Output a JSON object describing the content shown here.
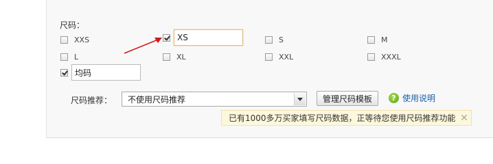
{
  "title": "尺码：",
  "sizes": [
    {
      "label": "XXS",
      "checked": false
    },
    {
      "label": "XS",
      "checked": true,
      "input_value": "XS"
    },
    {
      "label": "S",
      "checked": false
    },
    {
      "label": "M",
      "checked": false
    },
    {
      "label": "L",
      "checked": false
    },
    {
      "label": "XL",
      "checked": false
    },
    {
      "label": "XXL",
      "checked": false
    },
    {
      "label": "XXXL",
      "checked": false
    },
    {
      "label": "均码",
      "checked": true,
      "input_value": "均码"
    }
  ],
  "recommend": {
    "label": "尺码推荐：",
    "selected": "不使用尺码推荐",
    "manage_button": "管理尺码模板",
    "help_link": "使用说明",
    "help_icon": "question-icon"
  },
  "tip": {
    "text": "已有1000多万买家填写尺码数据，正等待您使用尺码推荐功能",
    "close": "✕"
  },
  "colors": {
    "arrow": "#d11a1a",
    "link": "#1b5ea8",
    "tip_bg": "#fdf7dc"
  }
}
